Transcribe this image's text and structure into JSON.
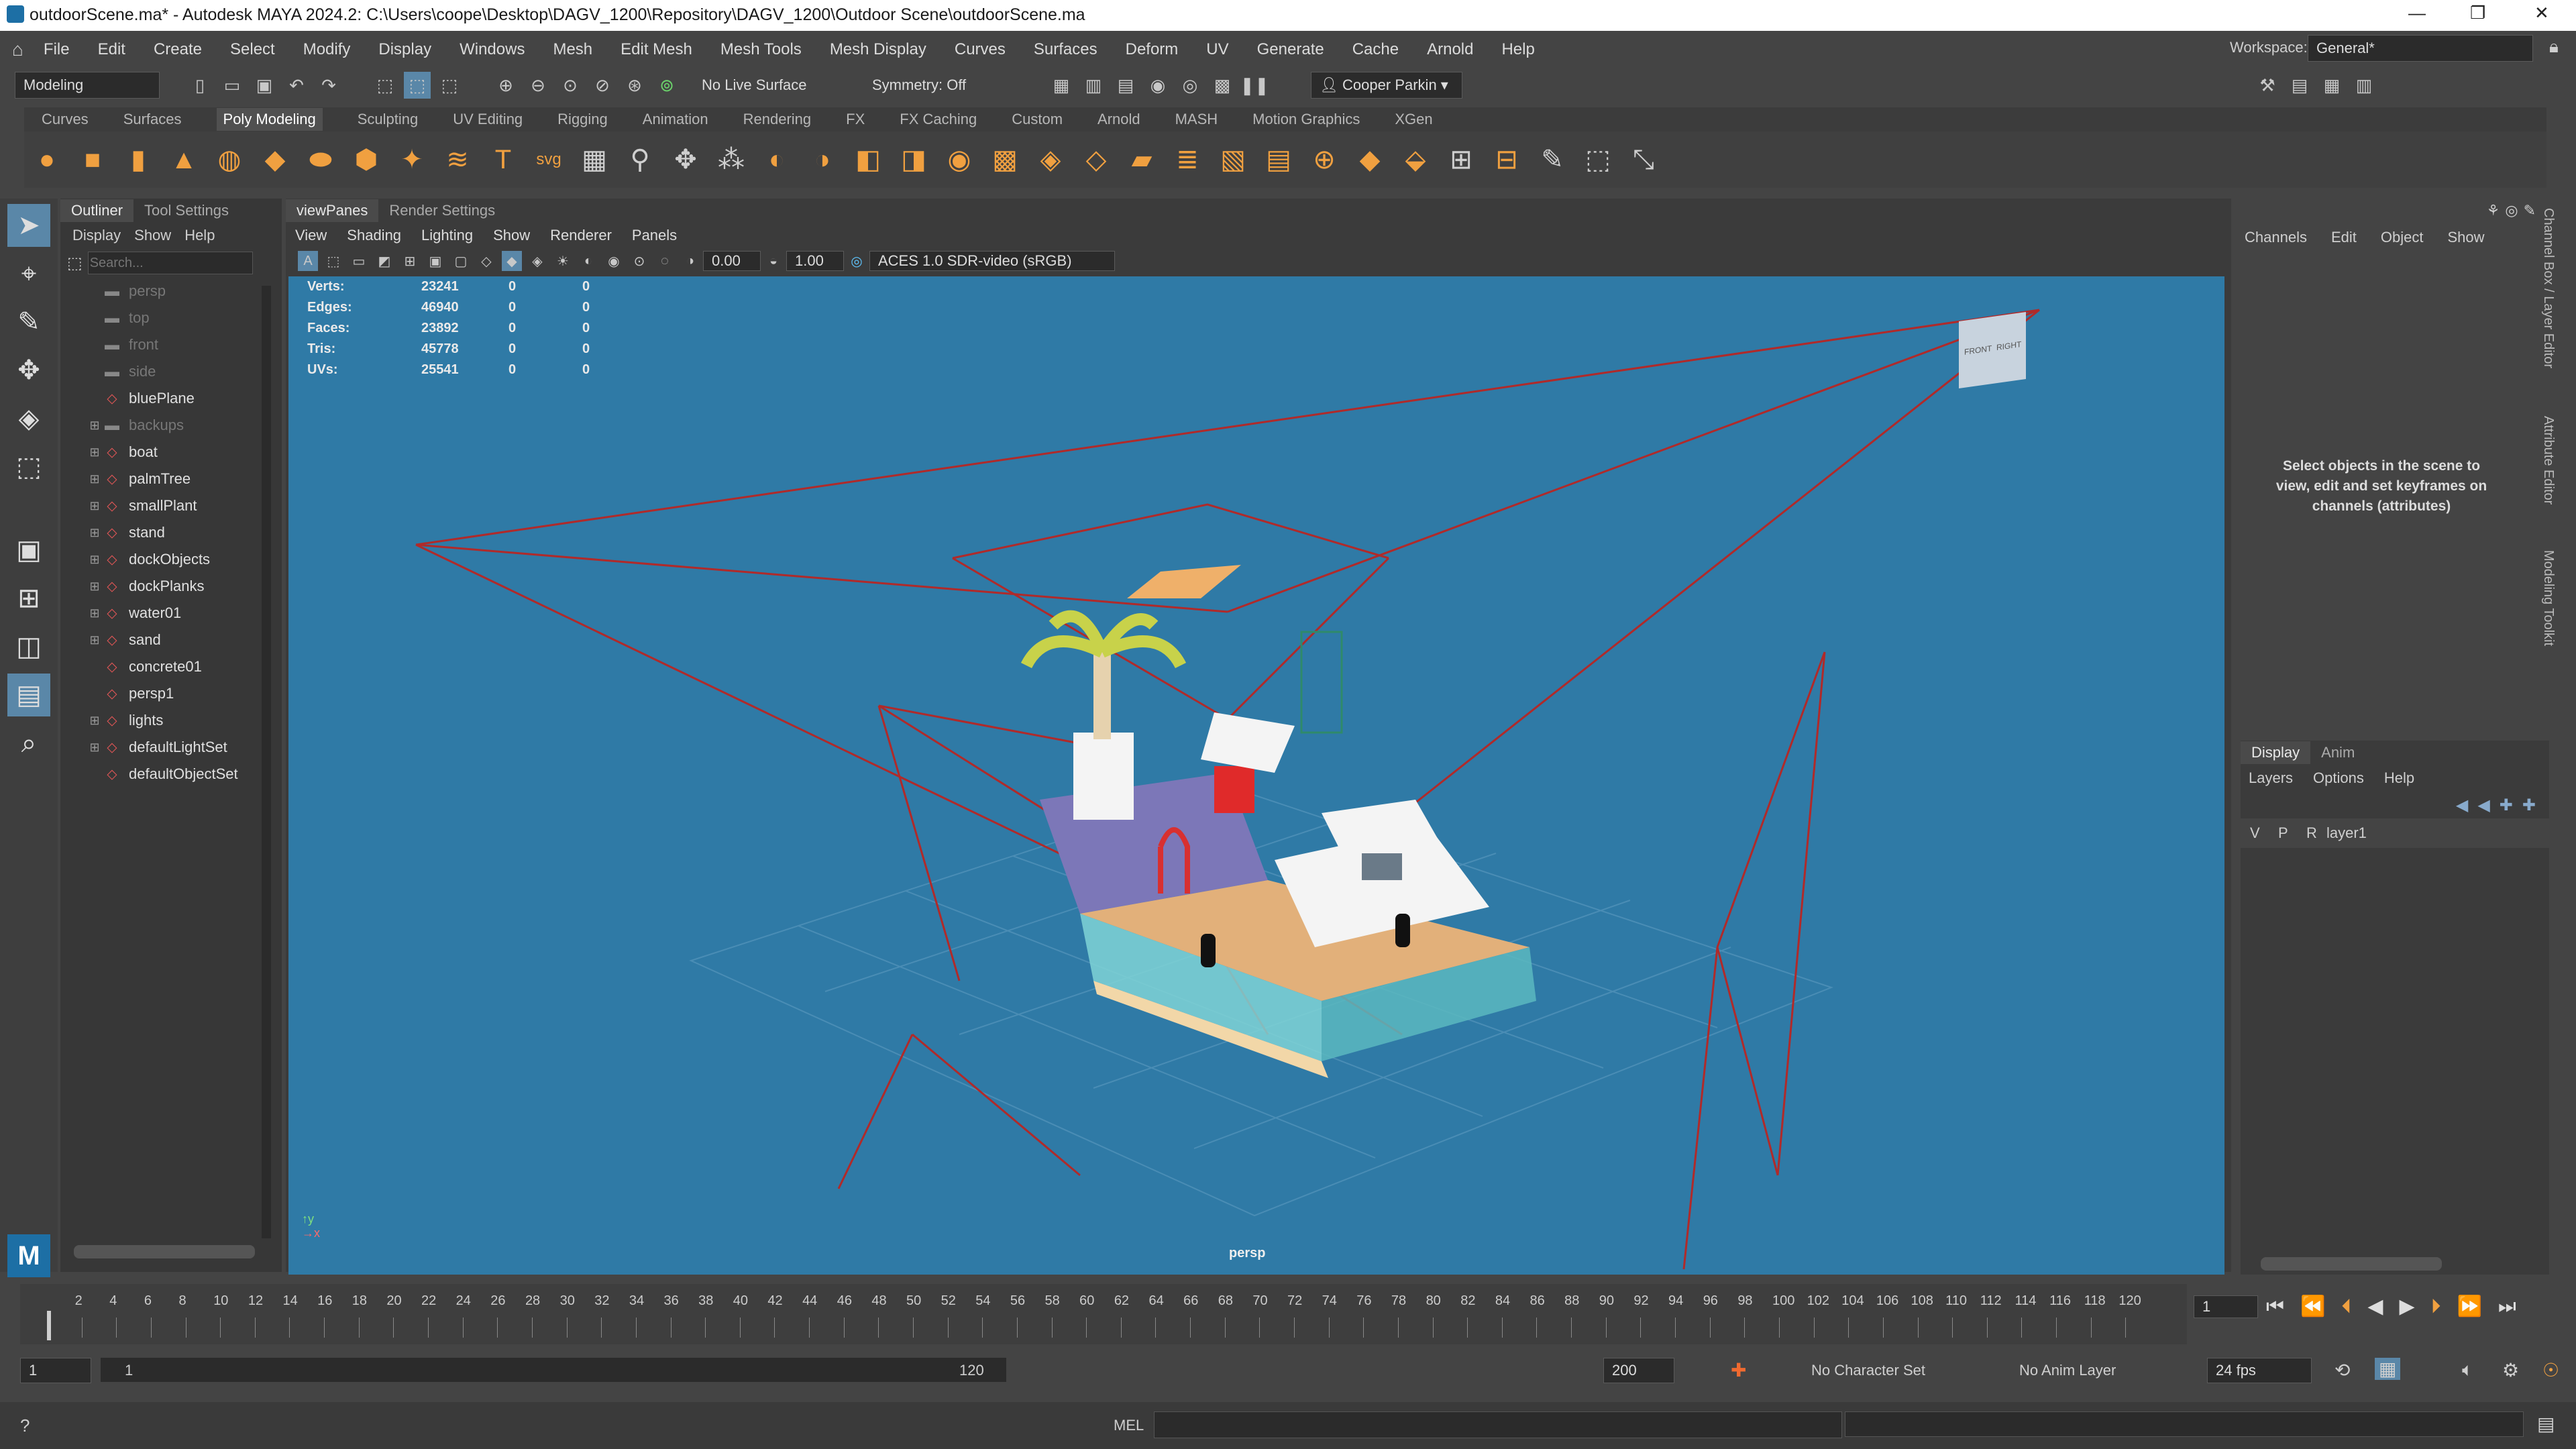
{
  "window": {
    "title": "outdoorScene.ma* - Autodesk MAYA 2024.2: C:\\Users\\coope\\Desktop\\DAGV_1200\\Repository\\DAGV_1200\\Outdoor Scene\\outdoorScene.ma",
    "minimize": "—",
    "maximize": "❐",
    "close": "✕"
  },
  "menu": [
    "File",
    "Edit",
    "Create",
    "Select",
    "Modify",
    "Display",
    "Windows",
    "Mesh",
    "Edit Mesh",
    "Mesh Tools",
    "Mesh Display",
    "Curves",
    "Surfaces",
    "Deform",
    "UV",
    "Generate",
    "Cache",
    "Arnold",
    "Help"
  ],
  "workspace": {
    "label": "Workspace:",
    "value": "General*"
  },
  "statusline": {
    "mode": "Modeling",
    "live_surface": "No Live Surface",
    "symmetry": "Symmetry: Off",
    "user": "Cooper Parkin"
  },
  "shelf_tabs": [
    "Curves",
    "Surfaces",
    "Poly Modeling",
    "Sculpting",
    "UV Editing",
    "Rigging",
    "Animation",
    "Rendering",
    "FX",
    "FX Caching",
    "Custom",
    "Arnold",
    "MASH",
    "Motion Graphics",
    "XGen"
  ],
  "shelf_active": "Poly Modeling",
  "outliner": {
    "tabs": [
      "Outliner",
      "Tool Settings"
    ],
    "menu": [
      "Display",
      "Show",
      "Help"
    ],
    "search_placeholder": "Search...",
    "items": [
      {
        "name": "persp",
        "dim": true,
        "expand": false
      },
      {
        "name": "top",
        "dim": true,
        "expand": false
      },
      {
        "name": "front",
        "dim": true,
        "expand": false
      },
      {
        "name": "side",
        "dim": true,
        "expand": false
      },
      {
        "name": "bluePlane",
        "dim": false,
        "expand": false
      },
      {
        "name": "backups",
        "dim": true,
        "expand": true
      },
      {
        "name": "boat",
        "dim": false,
        "expand": true
      },
      {
        "name": "palmTree",
        "dim": false,
        "expand": true
      },
      {
        "name": "smallPlant",
        "dim": false,
        "expand": true
      },
      {
        "name": "stand",
        "dim": false,
        "expand": true
      },
      {
        "name": "dockObjects",
        "dim": false,
        "expand": true
      },
      {
        "name": "dockPlanks",
        "dim": false,
        "expand": true
      },
      {
        "name": "water01",
        "dim": false,
        "expand": true
      },
      {
        "name": "sand",
        "dim": false,
        "expand": true
      },
      {
        "name": "concrete01",
        "dim": false,
        "expand": false
      },
      {
        "name": "persp1",
        "dim": false,
        "expand": false
      },
      {
        "name": "lights",
        "dim": false,
        "expand": true
      },
      {
        "name": "defaultLightSet",
        "dim": false,
        "expand": true
      },
      {
        "name": "defaultObjectSet",
        "dim": false,
        "expand": false
      }
    ]
  },
  "viewport": {
    "tabs": [
      "viewPanes",
      "Render Settings"
    ],
    "menu": [
      "View",
      "Shading",
      "Lighting",
      "Show",
      "Renderer",
      "Panels"
    ],
    "exposure": "0.00",
    "gamma": "1.00",
    "colorspace": "ACES 1.0 SDR-video (sRGB)",
    "camera_label": "persp",
    "viewcube_front": "FRONT",
    "viewcube_right": "RIGHT",
    "hud": [
      {
        "label": "Verts:",
        "v1": "23241",
        "v2": "0",
        "v3": "0"
      },
      {
        "label": "Edges:",
        "v1": "46940",
        "v2": "0",
        "v3": "0"
      },
      {
        "label": "Faces:",
        "v1": "23892",
        "v2": "0",
        "v3": "0"
      },
      {
        "label": "Tris:",
        "v1": "45778",
        "v2": "0",
        "v3": "0"
      },
      {
        "label": "UVs:",
        "v1": "25541",
        "v2": "0",
        "v3": "0"
      }
    ]
  },
  "channelbox": {
    "menu": [
      "Channels",
      "Edit",
      "Object",
      "Show"
    ],
    "message": "Select objects in the scene to view, edit and set keyframes on channels (attributes)",
    "side_tabs": [
      "Channel Box / Layer Editor",
      "Attribute Editor",
      "Modeling Toolkit"
    ]
  },
  "layers": {
    "tabs": [
      "Display",
      "Anim"
    ],
    "menu": [
      "Layers",
      "Options",
      "Help"
    ],
    "row": {
      "v": "V",
      "p": "P",
      "r": "R",
      "name": "layer1"
    }
  },
  "timeline": {
    "ticks": [
      "2",
      "4",
      "6",
      "8",
      "10",
      "12",
      "14",
      "16",
      "18",
      "20",
      "22",
      "24",
      "26",
      "28",
      "30",
      "32",
      "34",
      "36",
      "38",
      "40",
      "42",
      "44",
      "46",
      "48",
      "50",
      "52",
      "54",
      "56",
      "58",
      "60",
      "62",
      "64",
      "66",
      "68",
      "70",
      "72",
      "74",
      "76",
      "78",
      "80",
      "82",
      "84",
      "86",
      "88",
      "90",
      "92",
      "94",
      "96",
      "98",
      "100",
      "102",
      "104",
      "106",
      "108",
      "110",
      "112",
      "114",
      "116",
      "118",
      "120"
    ],
    "current_frame": "1"
  },
  "range": {
    "start": "1",
    "inner_start": "1",
    "inner_end": "120",
    "end": "200",
    "character_set": "No Character Set",
    "anim_layer": "No Anim Layer",
    "fps": "24 fps"
  },
  "cmd": {
    "lang": "MEL"
  },
  "colors": {
    "viewport_bg": "#2f7aa6",
    "wire_red": "#b02a2a",
    "panel": "#444444"
  }
}
